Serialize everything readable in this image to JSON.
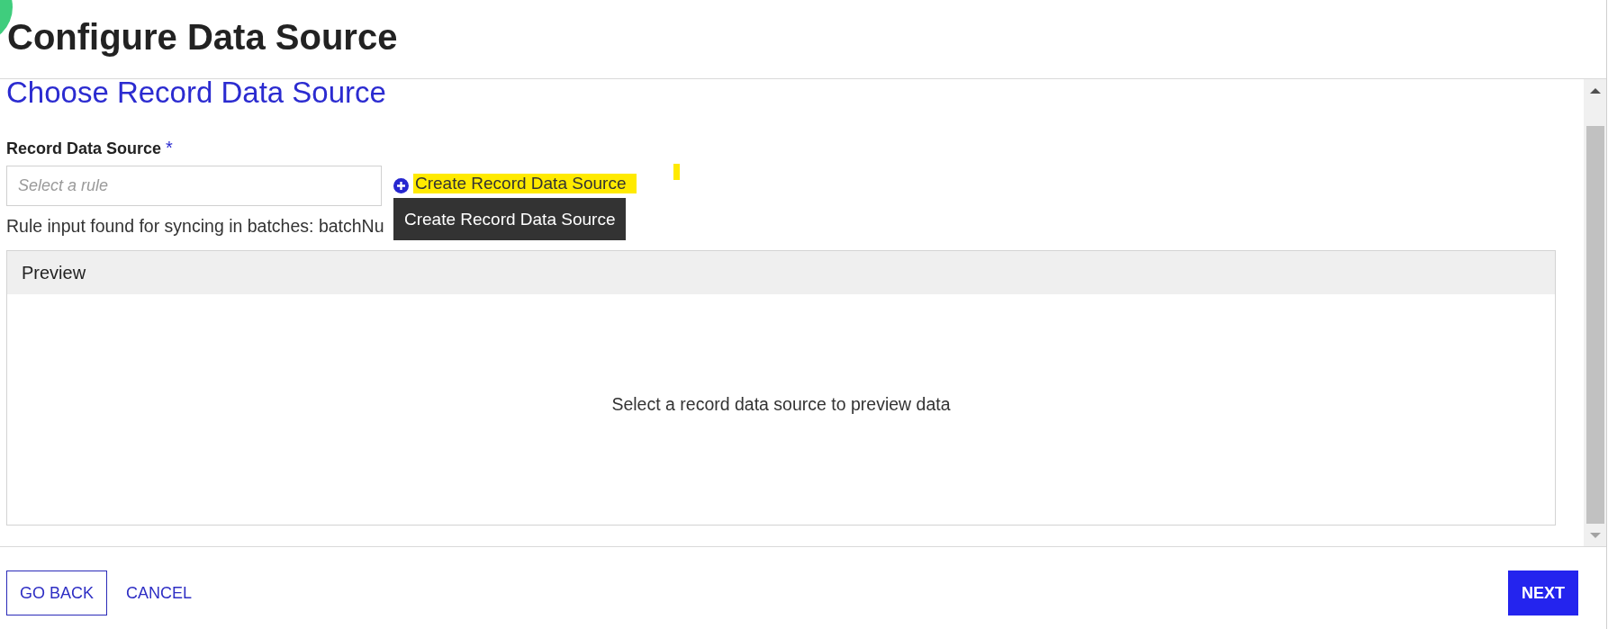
{
  "dialog": {
    "title": "Configure Data Source"
  },
  "step_title": "Choose Record Data Source",
  "record_data_source": {
    "label": "Record Data Source",
    "required_marker": "*",
    "placeholder": "Select a rule"
  },
  "create_link": {
    "label": "Create Record Data Source",
    "highlighted": true
  },
  "tooltip": {
    "text": "Create Record Data Source"
  },
  "rule_input_note": "Rule input found for syncing in batches: batchNu",
  "preview": {
    "title": "Preview",
    "empty_message": "Select a record data source to preview data"
  },
  "footer": {
    "left_buttons": [
      {
        "label": "GO BACK",
        "kind": "outlined"
      },
      {
        "label": "CANCEL",
        "kind": "text"
      }
    ],
    "right_buttons": [
      {
        "label": "NEXT",
        "kind": "primary"
      }
    ]
  }
}
